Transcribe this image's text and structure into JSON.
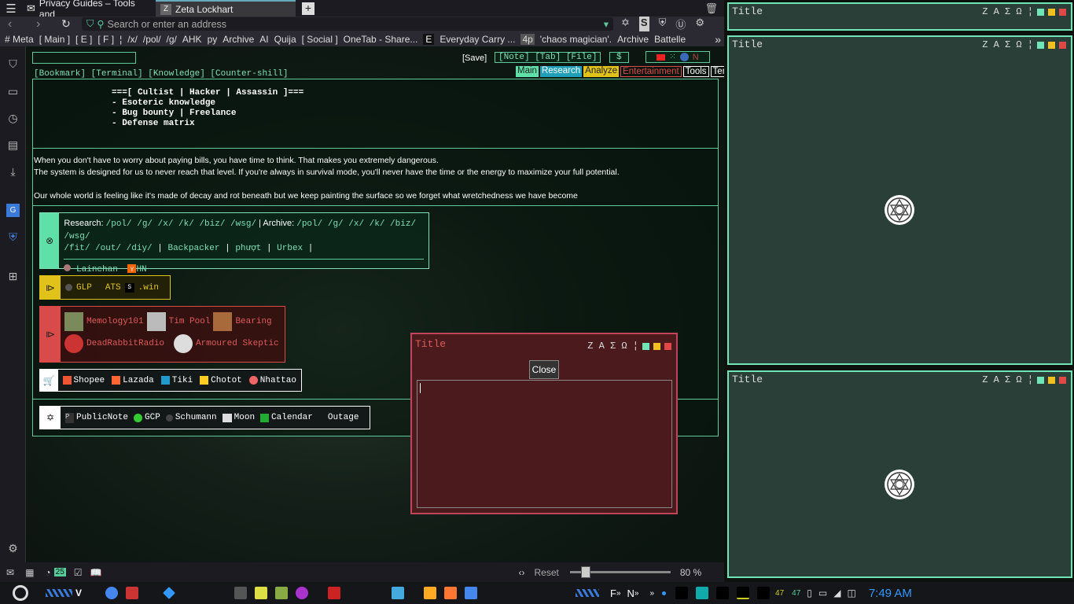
{
  "browser": {
    "tabs": [
      {
        "label": "Privacy Guides – Tools and"
      },
      {
        "label": "Zeta Lockhart"
      }
    ],
    "url_placeholder": "Search or enter an address",
    "bookmarks": [
      "# Meta",
      "[ Main ]",
      "[ E ]",
      "[ F ]",
      "¦",
      "/x/",
      "/pol/",
      "/g/",
      "AHK",
      "py",
      "Archive",
      "AI",
      "Quija",
      "[ Social ]",
      "OneTab - Share...",
      "E",
      "Everyday Carry ...",
      "4p",
      "'chaos magician'.",
      "Archive",
      "Battelle"
    ],
    "status": {
      "reset": "Reset",
      "zoom": "80 %",
      "badge": "25"
    }
  },
  "page": {
    "topnav": "[Bookmark] [Terminal] [Knowledge] [Counter-shill]",
    "save": "[Save]",
    "toolbox": "[Note] [Tab] [File]",
    "dollar": "$",
    "tabs": [
      "Main",
      "Research",
      "Analyze",
      "Entertainment",
      "Tools",
      "Temp"
    ],
    "tab_colors": [
      "#5fe0a8",
      "#2bb5c8",
      "#e0c21a",
      "#d94a4a",
      "#fff",
      "#fff"
    ],
    "ascii": [
      "===[ Cultist | Hacker | Assassin ]===",
      "- Esoteric knowledge",
      "- Bug bounty | Freelance",
      "- Defense matrix"
    ],
    "quote": [
      "When you don't have to worry about paying bills, you have time to think. That makes you extremely dangerous.",
      "The system is designed for us to never reach that level. If you're always in survival mode, you'll never have the time or the energy to maximize your full potential.",
      "Our whole world is feeling like it's made of decay and rot beneath but we keep painting the surface so we forget what wretchedness we have become"
    ],
    "research": {
      "label": "Research:",
      "links": "/pol/ /g/ /x/ /k/ /biz/ /wsg/",
      "archive_label": "| Archive:",
      "archive_links": "/pol/ /g/ /x/ /k/ /biz/ /wsg/",
      "line2": [
        "/fit/ /out/ /diy/",
        "Backpacker",
        "phượt",
        "Urbex"
      ],
      "sep": "|",
      "chans": [
        "Lainchan",
        "HN"
      ]
    },
    "yellow": {
      "links": [
        "GLP",
        "ATS",
        ".win"
      ]
    },
    "red": {
      "links": [
        "Memology101",
        "Tim Pool",
        "Bearing",
        "DeadRabbitRadio",
        "Armoured Skeptic"
      ]
    },
    "shop": {
      "links": [
        "Shopee",
        "Lazada",
        "Tiki",
        "Chotot",
        "Nhattao"
      ]
    },
    "tools": {
      "links": [
        "PublicNote",
        "GCP",
        "Schumann",
        "Moon",
        "Calendar",
        "Outage"
      ]
    }
  },
  "windows": {
    "title": "Title",
    "controls": "Z A Σ Ω ¦",
    "popup_title": "Title",
    "close": "Close"
  },
  "taskbar": {
    "clock": "7:49 AM",
    "n1": "47",
    "n2": "47",
    "f": "F",
    "n": "N"
  }
}
